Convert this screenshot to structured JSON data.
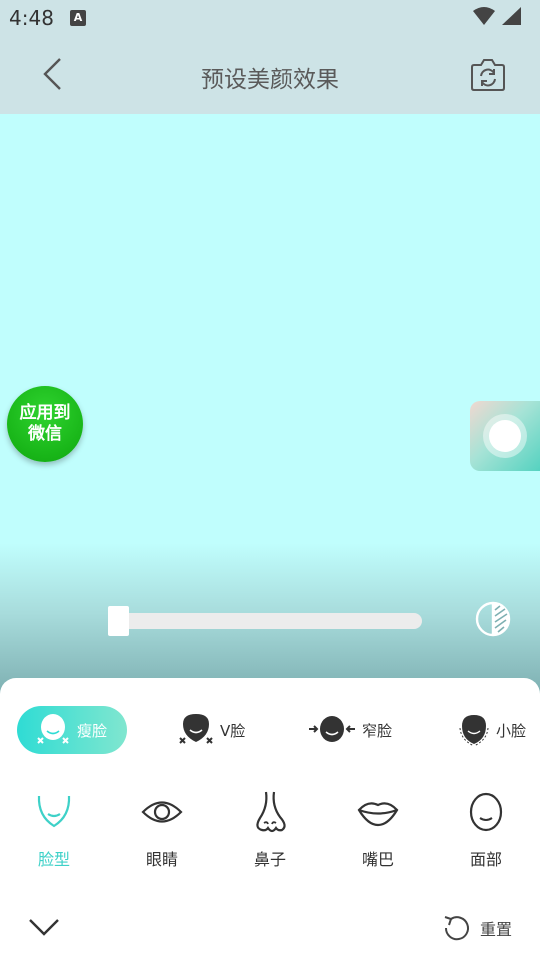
{
  "status_bar": {
    "time": "4:48",
    "notification_badge": "A"
  },
  "header": {
    "title": "预设美颜效果"
  },
  "preview": {
    "background_color": "#c0fefd"
  },
  "apply_button": {
    "line1": "应用到",
    "line2": "微信",
    "color": "#18b518"
  },
  "slider": {
    "value": 0
  },
  "sub_options": [
    {
      "label": "瘦脸",
      "icon": "slim-face-icon",
      "active": true
    },
    {
      "label": "V脸",
      "icon": "v-face-icon",
      "active": false
    },
    {
      "label": "窄脸",
      "icon": "narrow-face-icon",
      "active": false
    },
    {
      "label": "小脸",
      "icon": "small-face-icon",
      "active": false
    }
  ],
  "categories": [
    {
      "label": "脸型",
      "icon": "face-shape-icon",
      "active": true
    },
    {
      "label": "眼睛",
      "icon": "eye-icon",
      "active": false
    },
    {
      "label": "鼻子",
      "icon": "nose-icon",
      "active": false
    },
    {
      "label": "嘴巴",
      "icon": "mouth-icon",
      "active": false
    },
    {
      "label": "面部",
      "icon": "face-icon",
      "active": false
    }
  ],
  "footer": {
    "reset_label": "重置"
  },
  "colors": {
    "accent": "#3ed1c8",
    "header_bg": "#cde3e6",
    "panel_bg": "#ffffff"
  }
}
